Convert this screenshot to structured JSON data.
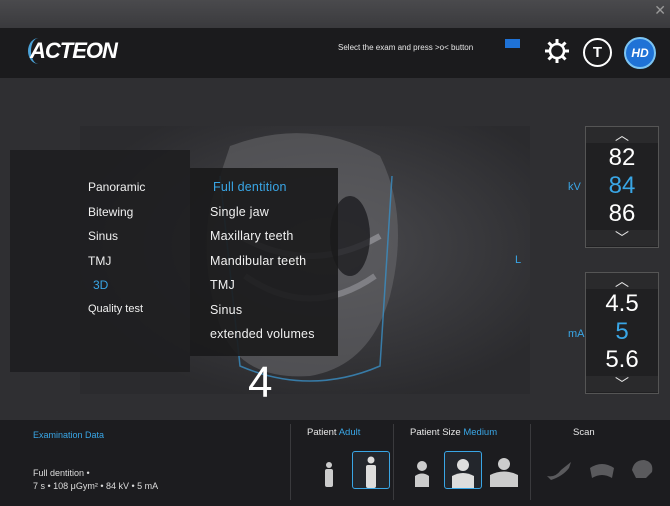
{
  "header": {
    "logo": "ACTEON",
    "instruction": "Select the exam and press >o< button",
    "icons": [
      "gear-icon",
      "timer-t-icon",
      "hd-icon"
    ]
  },
  "menu": {
    "categories": [
      "Panoramic",
      "Bitewing",
      "Sinus",
      "TMJ",
      "3D",
      "Quality test"
    ],
    "selected_category": "3D",
    "exams": [
      "Full dentition",
      "Single jaw",
      "Maxillary teeth",
      "Mandibular teeth",
      "TMJ",
      "Sinus",
      "extended volumes"
    ],
    "selected_exam": "Full dentition"
  },
  "image": {
    "side_label": "L",
    "step_number": "4"
  },
  "kv": {
    "unit": "kV",
    "values": [
      "82",
      "84",
      "86"
    ],
    "current": "84"
  },
  "ma": {
    "unit": "mA",
    "values": [
      "4.5",
      "5",
      "5.6"
    ],
    "current": "5"
  },
  "footer": {
    "exam_label": "Examination Data",
    "exam_line1": "Full dentition •",
    "exam_line2": "7 s • 108 μGym² • 84 kV • 5 mA",
    "patient_label": "Patient",
    "patient_value": "Adult",
    "size_label": "Patient Size",
    "size_value": "Medium",
    "scan_label": "Scan"
  },
  "colors": {
    "accent": "#39a6e6",
    "background": "#2b2b2e"
  }
}
